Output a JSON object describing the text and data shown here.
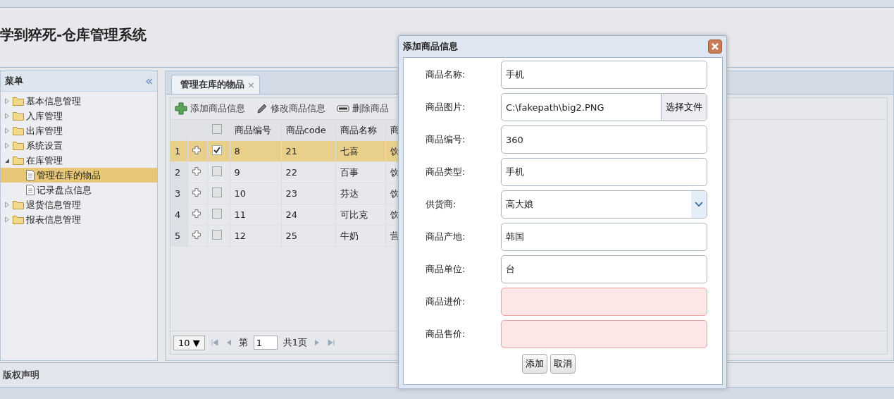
{
  "header": {
    "title": "学到猝死-仓库管理系统"
  },
  "menu": {
    "title": "菜单",
    "items": [
      {
        "label": "基本信息管理",
        "expanded": false,
        "selected": false
      },
      {
        "label": "入库管理",
        "expanded": false,
        "selected": false
      },
      {
        "label": "出库管理",
        "expanded": false,
        "selected": false
      },
      {
        "label": "系统设置",
        "expanded": false,
        "selected": false
      },
      {
        "label": "在库管理",
        "expanded": true,
        "selected": false,
        "children": [
          {
            "label": "管理在库的物品",
            "selected": true
          },
          {
            "label": "记录盘点信息",
            "selected": false
          }
        ]
      },
      {
        "label": "退货信息管理",
        "expanded": false,
        "selected": false
      },
      {
        "label": "报表信息管理",
        "expanded": false,
        "selected": false
      }
    ]
  },
  "tabs": [
    {
      "label": "管理在库的物品",
      "close": "×",
      "selected": true
    }
  ],
  "toolbar": [
    {
      "kind": "add",
      "label": "添加商品信息"
    },
    {
      "kind": "edit",
      "label": "修改商品信息"
    },
    {
      "kind": "remove",
      "label": "删除商品"
    }
  ],
  "table": {
    "header_checked": false,
    "columns": [
      "商品编号",
      "商品code",
      "商品名称",
      "商"
    ],
    "rows": [
      {
        "number": "1",
        "checked": true,
        "selected": true,
        "cells": [
          "8",
          "21",
          "七喜",
          "饮"
        ]
      },
      {
        "number": "2",
        "checked": false,
        "selected": false,
        "cells": [
          "9",
          "22",
          "百事",
          "饮"
        ]
      },
      {
        "number": "3",
        "checked": false,
        "selected": false,
        "cells": [
          "10",
          "23",
          "芬达",
          "饮"
        ]
      },
      {
        "number": "4",
        "checked": false,
        "selected": false,
        "cells": [
          "11",
          "24",
          "可比克",
          "饮"
        ]
      },
      {
        "number": "5",
        "checked": false,
        "selected": false,
        "cells": [
          "12",
          "25",
          "牛奶",
          "营"
        ]
      }
    ]
  },
  "pager": {
    "page_size": "10 ▼",
    "page_prefix": "第",
    "page": "1",
    "page_total": "共1页"
  },
  "footer": {
    "title": "版权声明"
  },
  "dialog": {
    "title": "添加商品信息",
    "fields": [
      {
        "kind": "text",
        "label": "商品名称:",
        "value": "手机",
        "invalid": false
      },
      {
        "kind": "file",
        "label": "商品图片:",
        "value": "C:\\fakepath\\big2.PNG",
        "button": "选择文件",
        "invalid": false
      },
      {
        "kind": "text",
        "label": "商品编号:",
        "value": "360",
        "invalid": false
      },
      {
        "kind": "text",
        "label": "商品类型:",
        "value": "手机",
        "invalid": false
      },
      {
        "kind": "select",
        "label": "供货商:",
        "value": "高大娘",
        "invalid": false
      },
      {
        "kind": "text",
        "label": "商品产地:",
        "value": "韩国",
        "invalid": false
      },
      {
        "kind": "text",
        "label": "商品单位:",
        "value": "台",
        "invalid": false
      },
      {
        "kind": "text",
        "label": "商品进价:",
        "invalid": true
      },
      {
        "kind": "text",
        "label": "商品售价:",
        "invalid": true
      }
    ],
    "buttons": [
      "添加",
      "取消"
    ]
  }
}
